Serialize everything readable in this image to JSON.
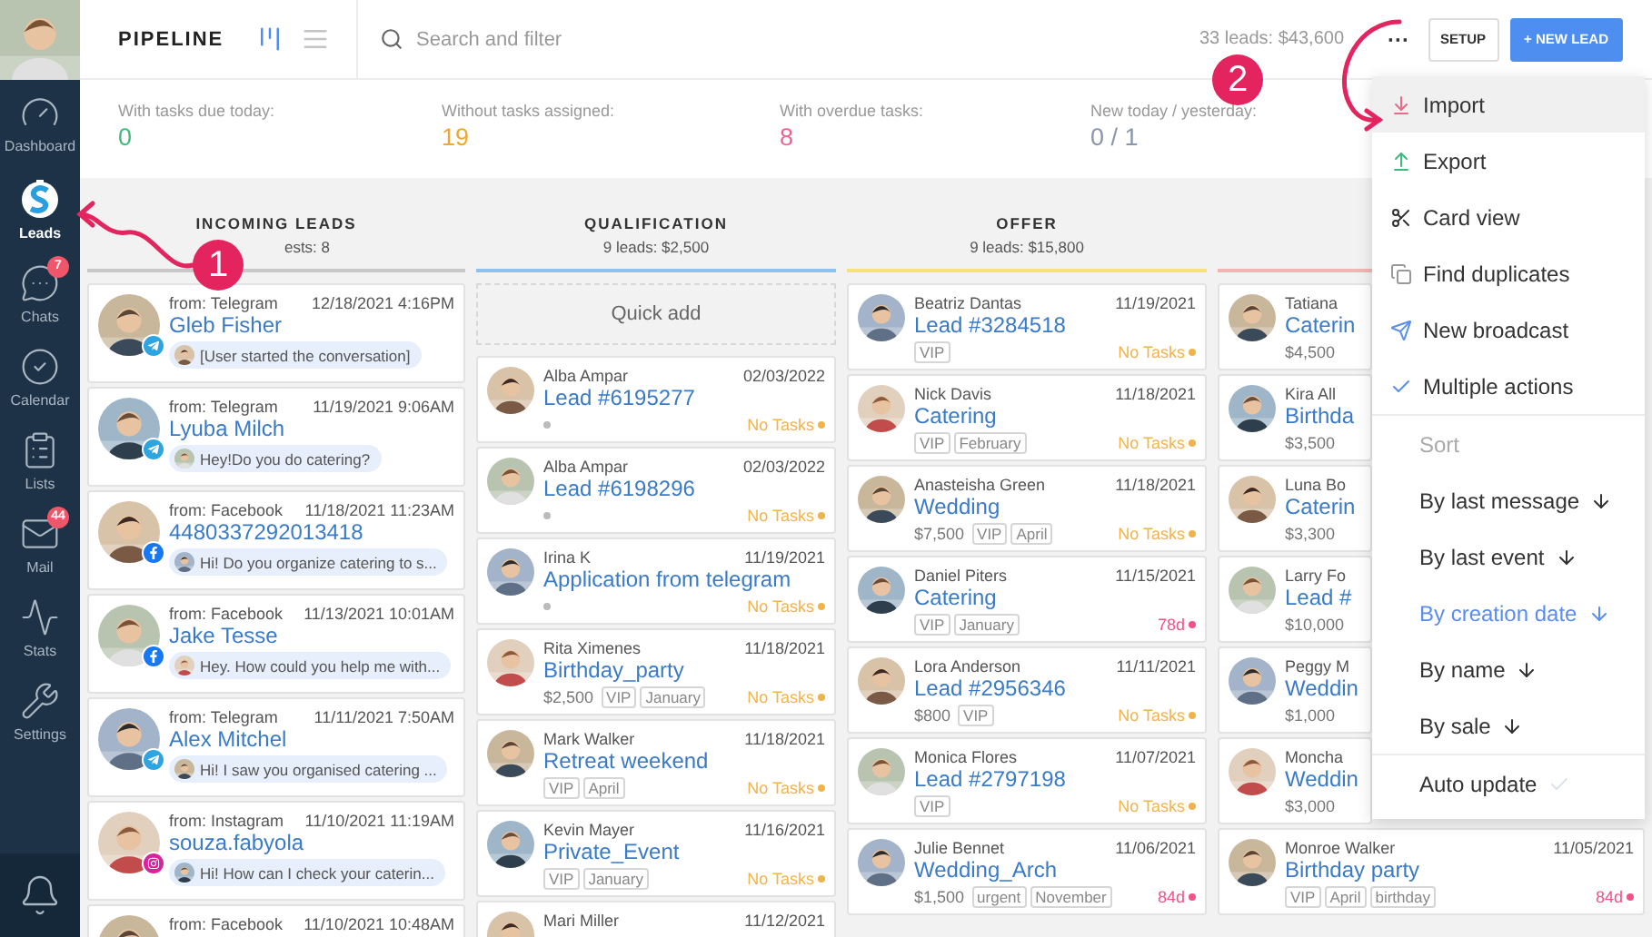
{
  "sidebar": {
    "items": [
      {
        "label": "Dashboard",
        "selected": false
      },
      {
        "label": "Leads",
        "selected": true
      },
      {
        "label": "Chats",
        "selected": false,
        "badge": "7"
      },
      {
        "label": "Calendar",
        "selected": false
      },
      {
        "label": "Lists",
        "selected": false
      },
      {
        "label": "Mail",
        "selected": false,
        "badge": "44"
      },
      {
        "label": "Stats",
        "selected": false
      },
      {
        "label": "Settings",
        "selected": false
      }
    ]
  },
  "toolbar": {
    "title": "PIPELINE",
    "views": [
      {
        "kind": "kanban",
        "selected": true
      },
      {
        "kind": "list",
        "selected": false
      }
    ],
    "search": {
      "placeholder": "Search and filter"
    },
    "summary": "33 leads: $43,600",
    "more": "···",
    "setup": "SETUP",
    "new_lead": "+ NEW LEAD"
  },
  "stats": [
    {
      "label": "With tasks due today:",
      "value": "0",
      "color": "#3dbb7d"
    },
    {
      "label": "Without tasks assigned:",
      "value": "19",
      "color": "#f0a630"
    },
    {
      "label": "With overdue tasks:",
      "value": "8",
      "color": "#f06292"
    },
    {
      "label": "New today / yesterday:",
      "value": "0 / 1",
      "color": "#8a96a8"
    }
  ],
  "columns": [
    {
      "kind": "incoming",
      "title": "INCOMING LEADS",
      "subtitle": "ests: 8",
      "color": "#c8c8c8",
      "cards": [
        {
          "source": "from: Telegram",
          "kind": "telegram",
          "date": "12/18/2021 4:16PM",
          "name": "Gleb Fisher",
          "message": "[User started the conversation]"
        },
        {
          "source": "from: Telegram",
          "kind": "telegram",
          "date": "11/19/2021 9:06AM",
          "name": "Lyuba Milch",
          "message": "Hey!Do you do catering?"
        },
        {
          "source": "from: Facebook",
          "kind": "facebook",
          "date": "11/18/2021 11:23AM",
          "name": "4480337292013418",
          "message": "Hi! Do you organize catering to s..."
        },
        {
          "source": "from: Facebook",
          "kind": "facebook",
          "date": "11/13/2021 10:01AM",
          "name": "Jake Tesse",
          "message": "Hey. How could you help me with..."
        },
        {
          "source": "from: Telegram",
          "kind": "telegram",
          "date": "11/11/2021 7:50AM",
          "name": "Alex Mitchel",
          "message": "Hi! I saw you organised catering ..."
        },
        {
          "source": "from: Instagram",
          "kind": "instagram",
          "date": "11/10/2021 11:19AM",
          "name": "souza.fabyola",
          "message": "Hi! How can I check your caterin..."
        },
        {
          "source": "from: Facebook",
          "date": "11/10/2021 10:48AM"
        }
      ]
    },
    {
      "kind": "deals",
      "title": "QUALIFICATION",
      "subtitle": "9 leads: $2,500",
      "color": "#8fc1f0",
      "quick_add": "Quick add",
      "cards": [
        {
          "contact": "Alba Ampar",
          "date": "02/03/2022",
          "title": "Lead #6195277",
          "task": {
            "text": "No Tasks",
            "overdue": false
          }
        },
        {
          "contact": "Alba Ampar",
          "date": "02/03/2022",
          "title": "Lead #6198296",
          "task": {
            "text": "No Tasks",
            "overdue": false
          }
        },
        {
          "contact": "Irina K",
          "date": "11/19/2021",
          "title": "Application from telegram",
          "task": {
            "text": "No Tasks",
            "overdue": false
          }
        },
        {
          "contact": "Rita Ximenes",
          "date": "11/18/2021",
          "title": "Birthday_party",
          "price": "$2,500",
          "tags": [
            "VIP",
            "January"
          ],
          "task": {
            "text": "No Tasks",
            "overdue": false
          }
        },
        {
          "contact": "Mark Walker",
          "date": "11/18/2021",
          "title": "Retreat weekend",
          "tags": [
            "VIP",
            "April"
          ],
          "task": {
            "text": "No Tasks",
            "overdue": false
          }
        },
        {
          "contact": "Kevin Mayer",
          "date": "11/16/2021",
          "title": "Private_Event",
          "tags": [
            "VIP",
            "January"
          ],
          "task": {
            "text": "No Tasks",
            "overdue": false
          }
        },
        {
          "contact": "Mari Miller",
          "date": "11/12/2021"
        }
      ]
    },
    {
      "kind": "deals",
      "title": "OFFER",
      "subtitle": "9 leads: $15,800",
      "color": "#f7e27a",
      "cards": [
        {
          "contact": "Beatriz Dantas",
          "date": "11/19/2021",
          "title": "Lead #3284518",
          "tags": [
            "VIP"
          ],
          "task": {
            "text": "No Tasks",
            "overdue": false
          }
        },
        {
          "contact": "Nick Davis",
          "date": "11/18/2021",
          "title": "Catering",
          "tags": [
            "VIP",
            "February"
          ],
          "task": {
            "text": "No Tasks",
            "overdue": false
          }
        },
        {
          "contact": "Anasteisha Green",
          "date": "11/18/2021",
          "title": "Wedding",
          "price": "$7,500",
          "tags": [
            "VIP",
            "April"
          ],
          "task": {
            "text": "No Tasks",
            "overdue": false
          }
        },
        {
          "contact": "Daniel Piters",
          "date": "11/15/2021",
          "title": "Catering",
          "tags": [
            "VIP",
            "January"
          ],
          "task": {
            "text": "78d",
            "overdue": true
          }
        },
        {
          "contact": "Lora Anderson",
          "date": "11/11/2021",
          "title": "Lead #2956346",
          "price": "$800",
          "tags": [
            "VIP"
          ],
          "task": {
            "text": "No Tasks",
            "overdue": false
          }
        },
        {
          "contact": "Monica Flores",
          "date": "11/07/2021",
          "title": "Lead #2797198",
          "tags": [
            "VIP"
          ],
          "task": {
            "text": "No Tasks",
            "overdue": false
          }
        },
        {
          "contact": "Julie Bennet",
          "date": "11/06/2021",
          "title": "Wedding_Arch",
          "price": "$1,500",
          "tags": [
            "urgent",
            "November"
          ],
          "task": {
            "text": "84d",
            "overdue": true
          }
        }
      ]
    },
    {
      "kind": "deals",
      "color": "#f4b4b4",
      "cards": [
        {
          "contact": "Tatiana",
          "title": "Caterin",
          "price": "$4,500"
        },
        {
          "contact": "Kira All",
          "title": "Birthda",
          "price": "$3,500"
        },
        {
          "contact": "Luna Bo",
          "title": "Caterin",
          "price": "$3,300"
        },
        {
          "contact": "Larry Fo",
          "title": "Lead #",
          "price": "$10,000"
        },
        {
          "contact": "Peggy M",
          "title": "Weddin",
          "price": "$1,000"
        },
        {
          "contact": "Moncha",
          "title": "Weddin",
          "price": "$3,000"
        },
        {
          "contact": "Monroe Walker",
          "date": "11/05/2021",
          "title": "Birthday party",
          "tags": [
            "VIP",
            "April",
            "birthday"
          ],
          "task": {
            "text": "84d",
            "overdue": true
          }
        }
      ]
    }
  ],
  "menu": {
    "items": [
      {
        "kind": "action",
        "label": "Import",
        "highlighted": true
      },
      {
        "kind": "action",
        "label": "Export",
        "highlighted": false
      },
      {
        "kind": "action",
        "label": "Card view",
        "highlighted": false
      },
      {
        "kind": "action",
        "label": "Find duplicates",
        "highlighted": false
      },
      {
        "kind": "action",
        "label": "New broadcast",
        "highlighted": false
      },
      {
        "kind": "action",
        "label": "Multiple actions",
        "highlighted": false
      },
      {
        "kind": "heading",
        "label": "Sort"
      },
      {
        "kind": "sort",
        "label": "By last message",
        "selected": false
      },
      {
        "kind": "sort",
        "label": "By last event",
        "selected": false
      },
      {
        "kind": "sort",
        "label": "By creation date",
        "selected": true
      },
      {
        "kind": "sort",
        "label": "By name",
        "selected": false
      },
      {
        "kind": "sort",
        "label": "By sale",
        "selected": false
      },
      {
        "kind": "toggle",
        "label": "Auto update",
        "checked": false
      }
    ]
  },
  "annotations": [
    {
      "label": "1"
    },
    {
      "label": "2"
    }
  ]
}
